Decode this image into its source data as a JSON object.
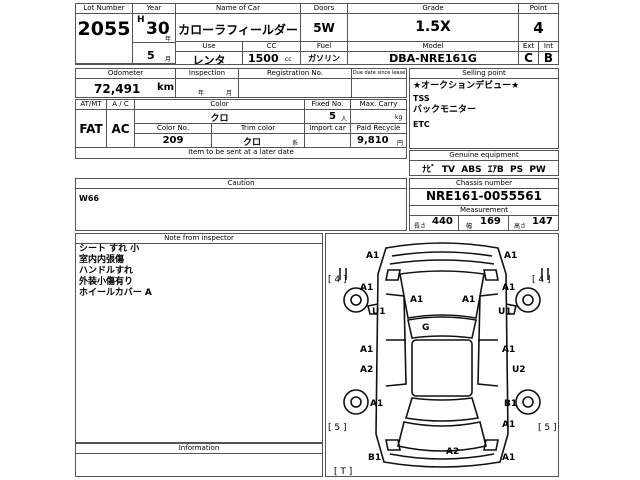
{
  "header": {
    "lot_number": {
      "label": "Lot Number",
      "value": "2055"
    },
    "year": {
      "label": "Year",
      "era": "H",
      "value": "30",
      "unit": "年"
    },
    "name_of_car": {
      "label": "Name of Car",
      "value": "カローラフィールダー"
    },
    "doors": {
      "label": "Doors",
      "value": "5W"
    },
    "grade": {
      "label": "Grade",
      "value": "1.5X"
    },
    "point": {
      "label": "Point",
      "value": "4"
    },
    "month": {
      "value": "5",
      "unit": "月"
    },
    "use": {
      "label": "Use",
      "value": "レンタ"
    },
    "cc": {
      "label": "CC",
      "value": "1500",
      "unit": "cc"
    },
    "fuel": {
      "label": "Fuel",
      "value": "ガソリン"
    },
    "model": {
      "label": "Model",
      "value": "DBA-NRE161G"
    },
    "ext": {
      "label": "Ext",
      "value": "C"
    },
    "int": {
      "label": "Int",
      "value": "B"
    }
  },
  "row2": {
    "odometer": {
      "label": "Odometer",
      "value": "72,491",
      "unit": "km"
    },
    "inspection": {
      "label": "Inspection",
      "year_unit": "年",
      "month_unit": "月"
    },
    "registration_no": {
      "label": "Registration No."
    },
    "due_date": {
      "label": "Due date since lease"
    },
    "selling_point": {
      "label": "Selling point",
      "lines": [
        "★オークションデビュー★",
        "TSS",
        "バックモニター",
        "ETC"
      ]
    }
  },
  "row3": {
    "atmt": {
      "label": "AT/MT",
      "value": "FAT"
    },
    "ac": {
      "label": "A / C",
      "value": "AC"
    },
    "color": {
      "label": "Color",
      "value": "クロ"
    },
    "fixed_no": {
      "label": "Fixed No.",
      "value": "5",
      "unit": "人"
    },
    "max_carry": {
      "label": "Max. Carry",
      "unit": "kg"
    },
    "color_no": {
      "label": "Color No.",
      "value": "209"
    },
    "trim_color": {
      "label": "Trim color",
      "value": "クロ",
      "unit": "系"
    },
    "import_car": {
      "label": "Import car"
    },
    "paid_recycle": {
      "label": "Paid Recycle",
      "value": "9,810",
      "unit": "円"
    },
    "item_later": {
      "label": "Item to be sent at a later date"
    },
    "genuine_equipment": {
      "label": "Genuine equipment",
      "value": "ﾅﾋﾞ  TV  ABS  ｴｱB  PS  PW"
    }
  },
  "caution": {
    "label": "Caution",
    "value": "W66"
  },
  "chassis": {
    "label": "Chassis number",
    "value": "NRE161-0055561"
  },
  "measurement": {
    "label": "Measurement",
    "length_label": "長さ",
    "length": "440",
    "width_label": "幅",
    "width": "169",
    "height_label": "高さ",
    "height": "147"
  },
  "inspector_note": {
    "label": "Note from inspector",
    "lines": [
      "シート すれ 小",
      "室内内張傷",
      "ハンドルすれ",
      "外装小傷有り",
      "ホイールカバー A"
    ]
  },
  "information": {
    "label": "Information"
  },
  "diagram": {
    "marks": [
      "A1",
      "A1",
      "A1",
      "A1",
      "A1",
      "A1",
      "U1",
      "U1",
      "G",
      "A1",
      "A1",
      "A2",
      "U2",
      "A1",
      "B1",
      "A1",
      "B1",
      "A2",
      "A1"
    ],
    "brackets": [
      "[ 4 ]",
      "[ 4 ]",
      "[ 5 ]",
      "[ 5 ]",
      "[ T ]"
    ]
  }
}
